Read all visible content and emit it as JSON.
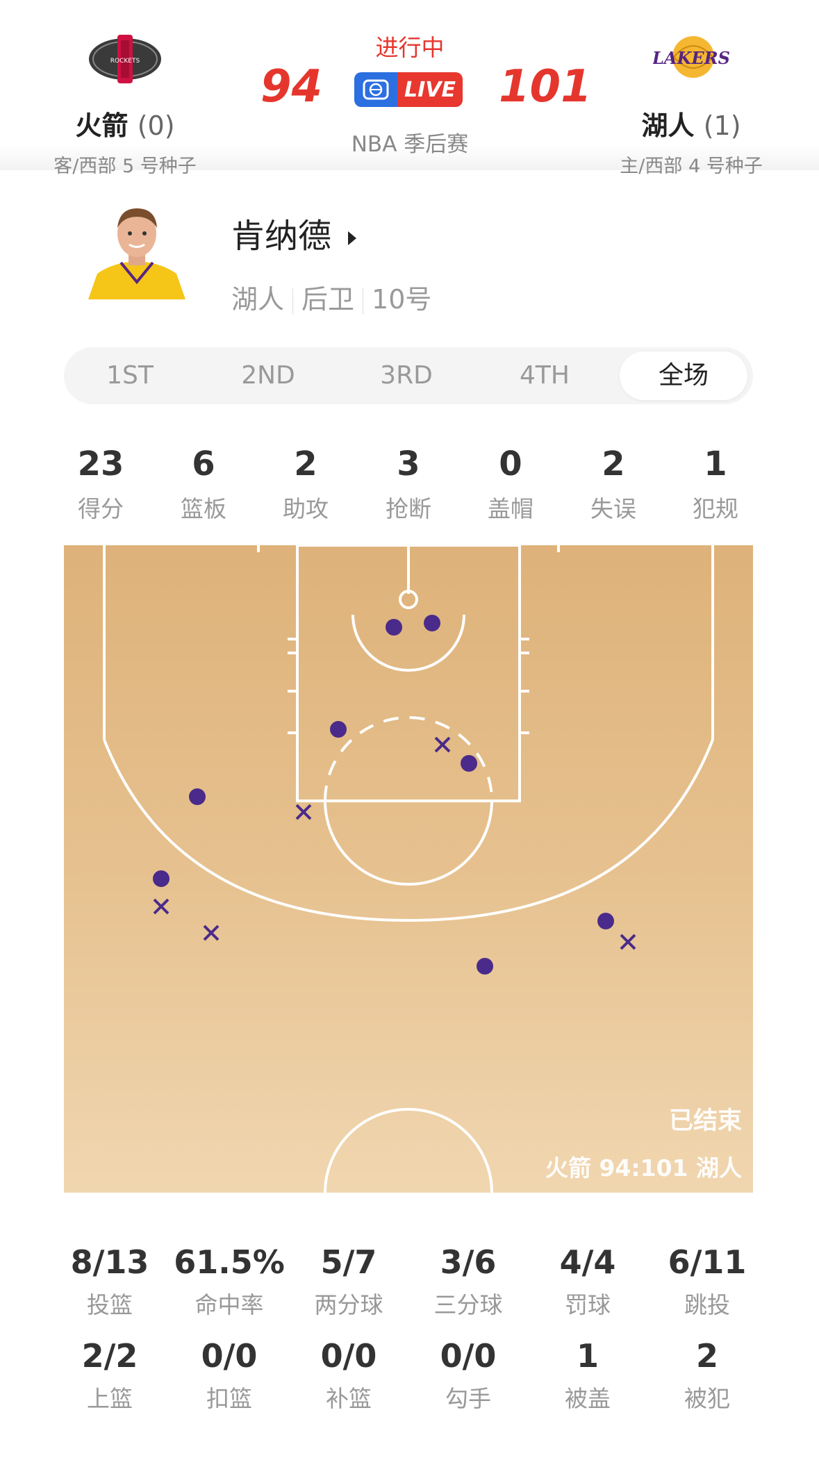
{
  "game": {
    "status": "进行中",
    "league": "NBA 季后赛",
    "live_label": "LIVE",
    "away": {
      "name": "火箭",
      "wins": "(0)",
      "seed": "客/西部 5 号种子",
      "score": "94",
      "logo_text": "HOUSTON ROCKETS"
    },
    "home": {
      "name": "湖人",
      "wins": "(1)",
      "seed": "主/西部 4 号种子",
      "score": "101",
      "logo_text": "LAKERS"
    }
  },
  "player": {
    "name": "肯纳德",
    "team": "湖人",
    "position": "后卫",
    "number": "10号"
  },
  "tabs": [
    "1ST",
    "2ND",
    "3RD",
    "4TH",
    "全场"
  ],
  "active_tab": "全场",
  "stats": [
    {
      "value": "23",
      "label": "得分"
    },
    {
      "value": "6",
      "label": "篮板"
    },
    {
      "value": "2",
      "label": "助攻"
    },
    {
      "value": "3",
      "label": "抢断"
    },
    {
      "value": "0",
      "label": "盖帽"
    },
    {
      "value": "2",
      "label": "失误"
    },
    {
      "value": "1",
      "label": "犯规"
    }
  ],
  "court": {
    "status": "已结束",
    "final_score": "火箭 94:101 湖人",
    "shot_color": "#4a2a8a"
  },
  "shooting": [
    {
      "value": "8/13",
      "label": "投篮"
    },
    {
      "value": "61.5%",
      "label": "命中率"
    },
    {
      "value": "5/7",
      "label": "两分球"
    },
    {
      "value": "3/6",
      "label": "三分球"
    },
    {
      "value": "4/4",
      "label": "罚球"
    },
    {
      "value": "6/11",
      "label": "跳投"
    },
    {
      "value": "2/2",
      "label": "上篮"
    },
    {
      "value": "0/0",
      "label": "扣篮"
    },
    {
      "value": "0/0",
      "label": "补篮"
    },
    {
      "value": "0/0",
      "label": "勾手"
    },
    {
      "value": "1",
      "label": "被盖"
    },
    {
      "value": "2",
      "label": "被犯"
    }
  ],
  "colors": {
    "accent_red": "#e5362d",
    "live_blue": "#2b6fe0",
    "lakers_purple": "#4a2a8a",
    "lakers_gold": "#f5b731"
  }
}
